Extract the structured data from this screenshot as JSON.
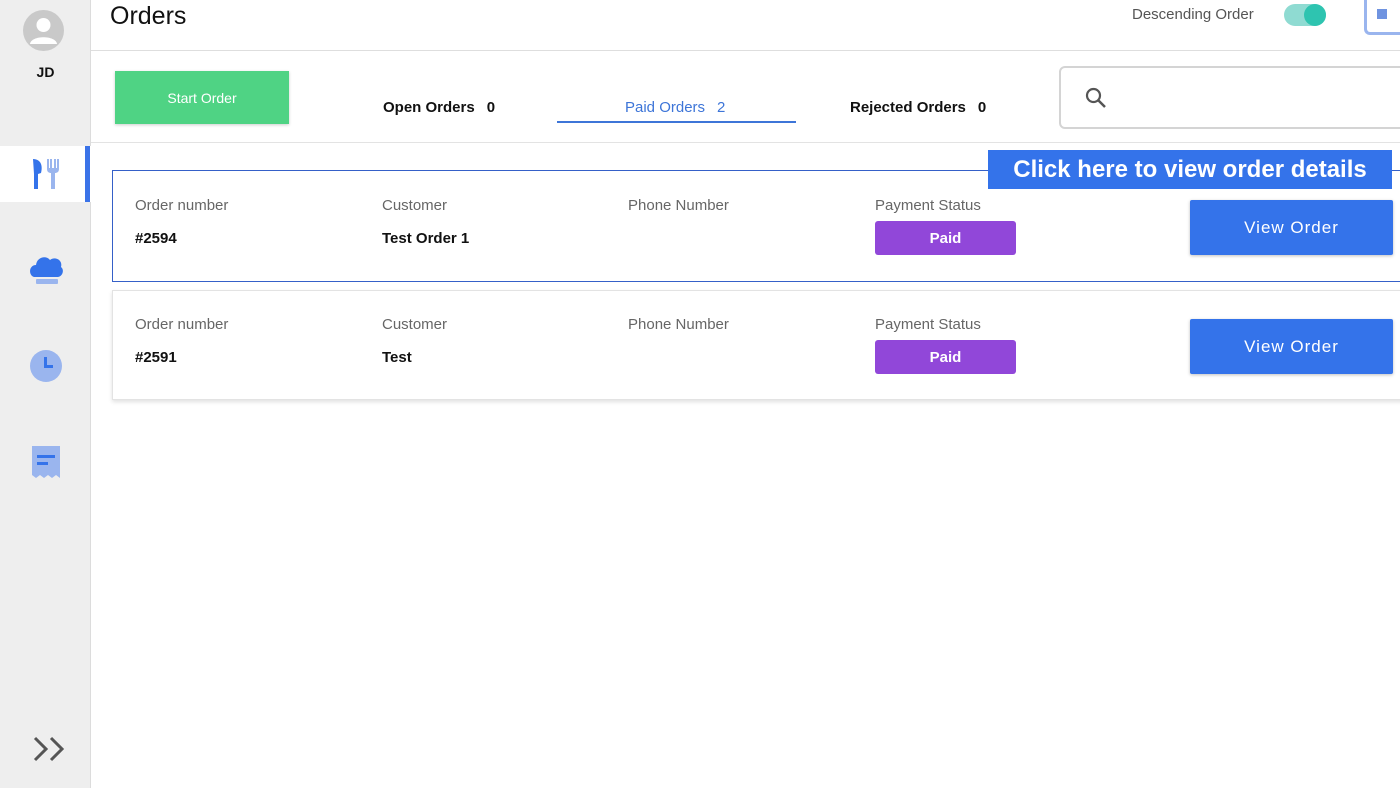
{
  "user": {
    "initials": "JD"
  },
  "nav": {
    "items": [
      {
        "icon": "restaurant-icon",
        "active": true
      },
      {
        "icon": "chef-hat-icon",
        "active": false
      },
      {
        "icon": "clock-icon",
        "active": false
      },
      {
        "icon": "receipt-icon",
        "active": false
      }
    ],
    "expand_icon": "double-chevron-right-icon"
  },
  "header": {
    "title": "Orders",
    "sort_label": "Descending Order",
    "sort_toggle_on": true
  },
  "toolbar": {
    "start_order_label": "Start Order",
    "tabs": [
      {
        "label": "Open Orders",
        "count": "0",
        "active": false
      },
      {
        "label": "Paid Orders",
        "count": "2",
        "active": true
      },
      {
        "label": "Rejected Orders",
        "count": "0",
        "active": false
      }
    ],
    "search": {
      "placeholder": "",
      "value": ""
    }
  },
  "columns": {
    "order_number": "Order number",
    "customer": "Customer",
    "phone": "Phone Number",
    "payment_status": "Payment Status"
  },
  "orders": [
    {
      "number": "#2594",
      "customer": "Test Order 1",
      "phone": "",
      "status": "Paid",
      "action": "View Order"
    },
    {
      "number": "#2591",
      "customer": "Test",
      "phone": "",
      "status": "Paid",
      "action": "View Order"
    }
  ],
  "callout": {
    "text": "Click here to view order details"
  },
  "colors": {
    "accent": "#3473ea",
    "start_button": "#4fd384",
    "paid_badge": "#9147d9",
    "toggle": "#2ec4b0"
  }
}
